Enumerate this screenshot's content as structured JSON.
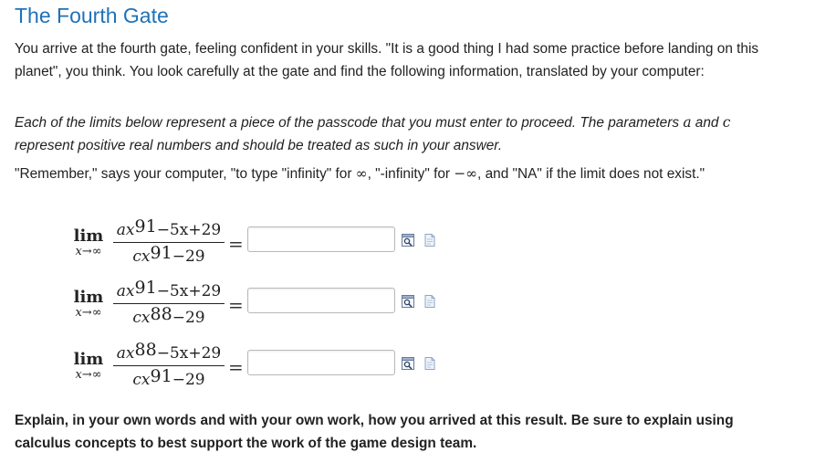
{
  "title": "The Fourth Gate",
  "intro": "You arrive at the fourth gate, feeling confident in your skills. \"It is a good thing I had some practice before landing on this planet\", you think. You look carefully at the gate and find the following information, translated by your computer:",
  "instructions": {
    "before_a": "Each of the limits below represent a piece of the passcode that you must enter to proceed. The parameters ",
    "param_a": "a",
    "and_word": " and ",
    "param_c": "c",
    "after_c": " represent positive real numbers and should be treated as such in your answer."
  },
  "remember": {
    "part1": "\"Remember,\" says your computer, \"to type \"infinity\" for ",
    "infinity_symbol": "∞",
    "part2": ", \"-infinity\" for ",
    "neg_infinity_symbol": "−∞",
    "part3": ", and \"NA\" if the limit does not exist.\""
  },
  "limits": [
    {
      "lim": "lim",
      "sub": "x→∞",
      "num_coef": "ax",
      "num_exp": "91",
      "num_rest": "−5x+29",
      "den_coef": "cx",
      "den_exp": "91",
      "den_rest": "−29",
      "equals": "=",
      "answer": ""
    },
    {
      "lim": "lim",
      "sub": "x→∞",
      "num_coef": "ax",
      "num_exp": "91",
      "num_rest": "−5x+29",
      "den_coef": "cx",
      "den_exp": "88",
      "den_rest": "−29",
      "equals": "=",
      "answer": ""
    },
    {
      "lim": "lim",
      "sub": "x→∞",
      "num_coef": "ax",
      "num_exp": "88",
      "num_rest": "−5x+29",
      "den_coef": "cx",
      "den_exp": "91",
      "den_rest": "−29",
      "equals": "=",
      "answer": ""
    }
  ],
  "explain": "Explain, in your own words and with your own work, how you arrived at this result. Be sure to explain using calculus concepts to best support the work of the game design team.",
  "icons": {
    "preview": "preview-answer-icon",
    "help": "entry-help-icon"
  }
}
